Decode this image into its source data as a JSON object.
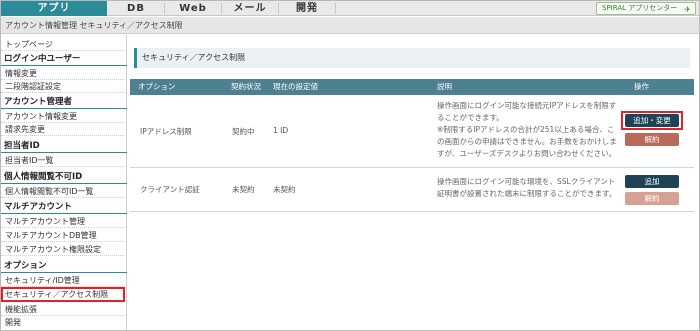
{
  "nav": {
    "tabs": [
      "アプリ",
      "DB",
      "Web",
      "メール",
      "開発"
    ],
    "active_tab": "アプリ",
    "spiral_label": "SPIRAL アプリセンター"
  },
  "breadcrumb": "アカウント情報管理 セキュリティ／アクセス制限",
  "sidebar": {
    "top": "トップページ",
    "login_user": {
      "heading": "ログイン中ユーザー",
      "items": [
        "情報変更",
        "二段階認証設定"
      ]
    },
    "account_admin": {
      "heading": "アカウント管理者",
      "items": [
        "アカウント情報変更",
        "請求先変更"
      ]
    },
    "staff_id": {
      "heading": "担当者ID",
      "items": [
        "担当者ID一覧"
      ]
    },
    "personal_info": {
      "heading": "個人情報閲覧不可ID",
      "items": [
        "個人情報閲覧不可ID一覧"
      ]
    },
    "multi_account": {
      "heading": "マルチアカウント",
      "items": [
        "マルチアカウント管理",
        "マルチアカウントDB管理",
        "マルチアカウント権限設定"
      ]
    },
    "options": {
      "heading": "オプション",
      "items": [
        "セキュリティ/ID管理",
        "セキュリティ／アクセス制限",
        "機能拡張",
        "開発"
      ]
    }
  },
  "main": {
    "title": "セキュリティ／アクセス制限",
    "columns": [
      "オプション",
      "契約状況",
      "現在の設定値",
      "説明",
      "操作"
    ],
    "rows": [
      {
        "option": "IPアドレス制限",
        "status": "契約中",
        "value": "1 ID",
        "desc_lines": [
          "操作画面にログイン可能な接続元IPアドレスを制限す",
          "ることができます。",
          "※制限するIPアドレスの合計が251以上ある場合、こ",
          "の画面からの申請はできません。お手数をおかけしま",
          "すが、ユーザーズデスクよりお問い合わせください。"
        ],
        "primary_button": "追加・変更",
        "secondary_button": "解約"
      },
      {
        "option": "クライアント認証",
        "status": "未契約",
        "value": "未契約",
        "desc_lines": [
          "操作画面にログイン可能な環境を、SSLクライアント",
          "証明書が設置された端末に制限することができます。"
        ],
        "primary_button": "追加",
        "secondary_button": "解約"
      }
    ]
  },
  "colors": {
    "accent": "#2d8a99",
    "header_bg": "#4d8192",
    "dark_button": "#1f4356",
    "cancel_button": "#b96a5a",
    "highlight": "#e0232a"
  }
}
